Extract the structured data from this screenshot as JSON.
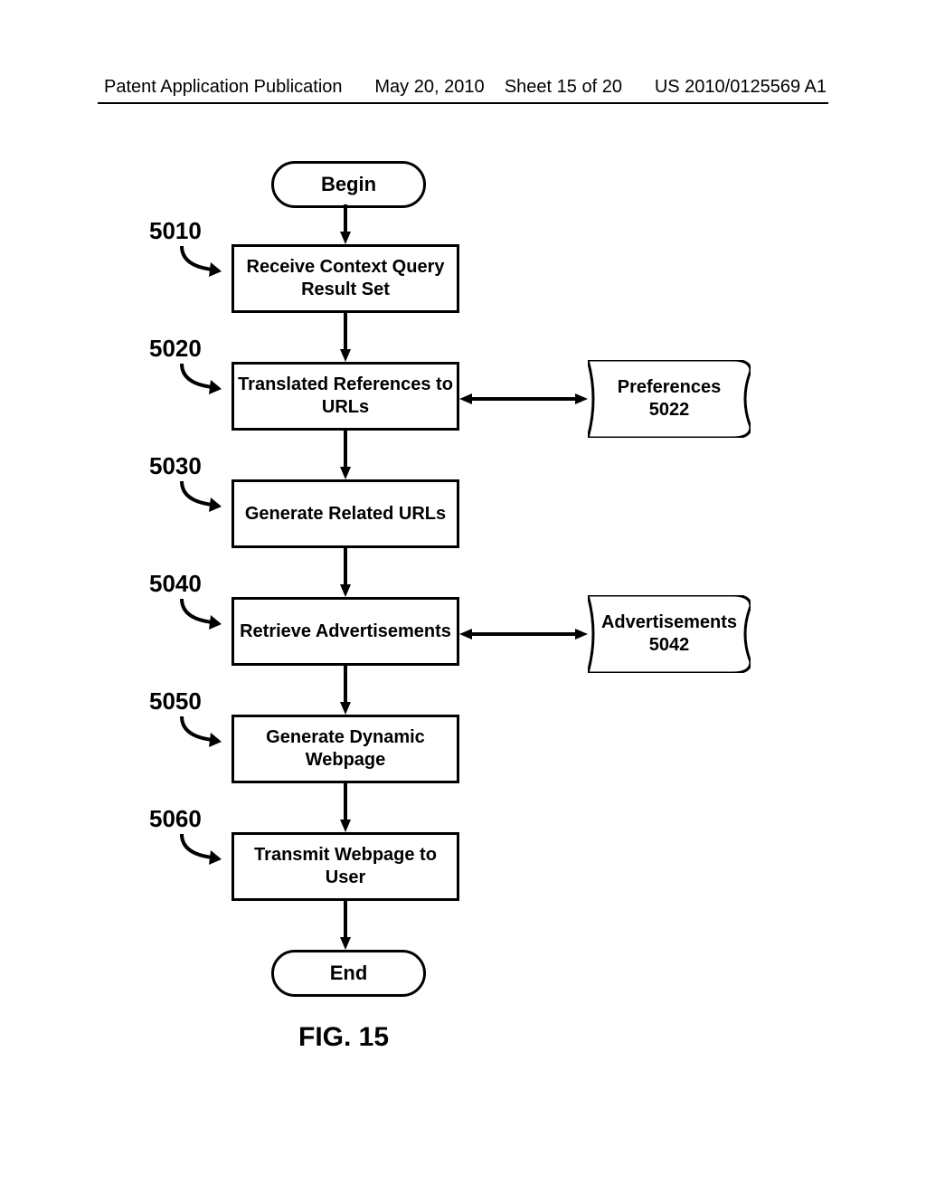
{
  "header": {
    "pub_label": "Patent Application Publication",
    "pub_date": "May 20, 2010",
    "sheet": "Sheet 15 of 20",
    "pub_id": "US 2010/0125569 A1"
  },
  "figure_label": "FIG. 15",
  "flow": {
    "begin": "Begin",
    "end": "End",
    "steps": [
      {
        "ref": "5010",
        "text": "Receive Context Query Result Set"
      },
      {
        "ref": "5020",
        "text": "Translated References to URLs"
      },
      {
        "ref": "5030",
        "text": "Generate Related URLs"
      },
      {
        "ref": "5040",
        "text": "Retrieve Advertisements"
      },
      {
        "ref": "5050",
        "text": "Generate Dynamic Webpage"
      },
      {
        "ref": "5060",
        "text": "Transmit Webpage to User"
      }
    ],
    "stores": [
      {
        "ref": "5022",
        "label": "Preferences",
        "linked_step_ref": "5020"
      },
      {
        "ref": "5042",
        "label": "Advertisements",
        "linked_step_ref": "5040"
      }
    ]
  }
}
